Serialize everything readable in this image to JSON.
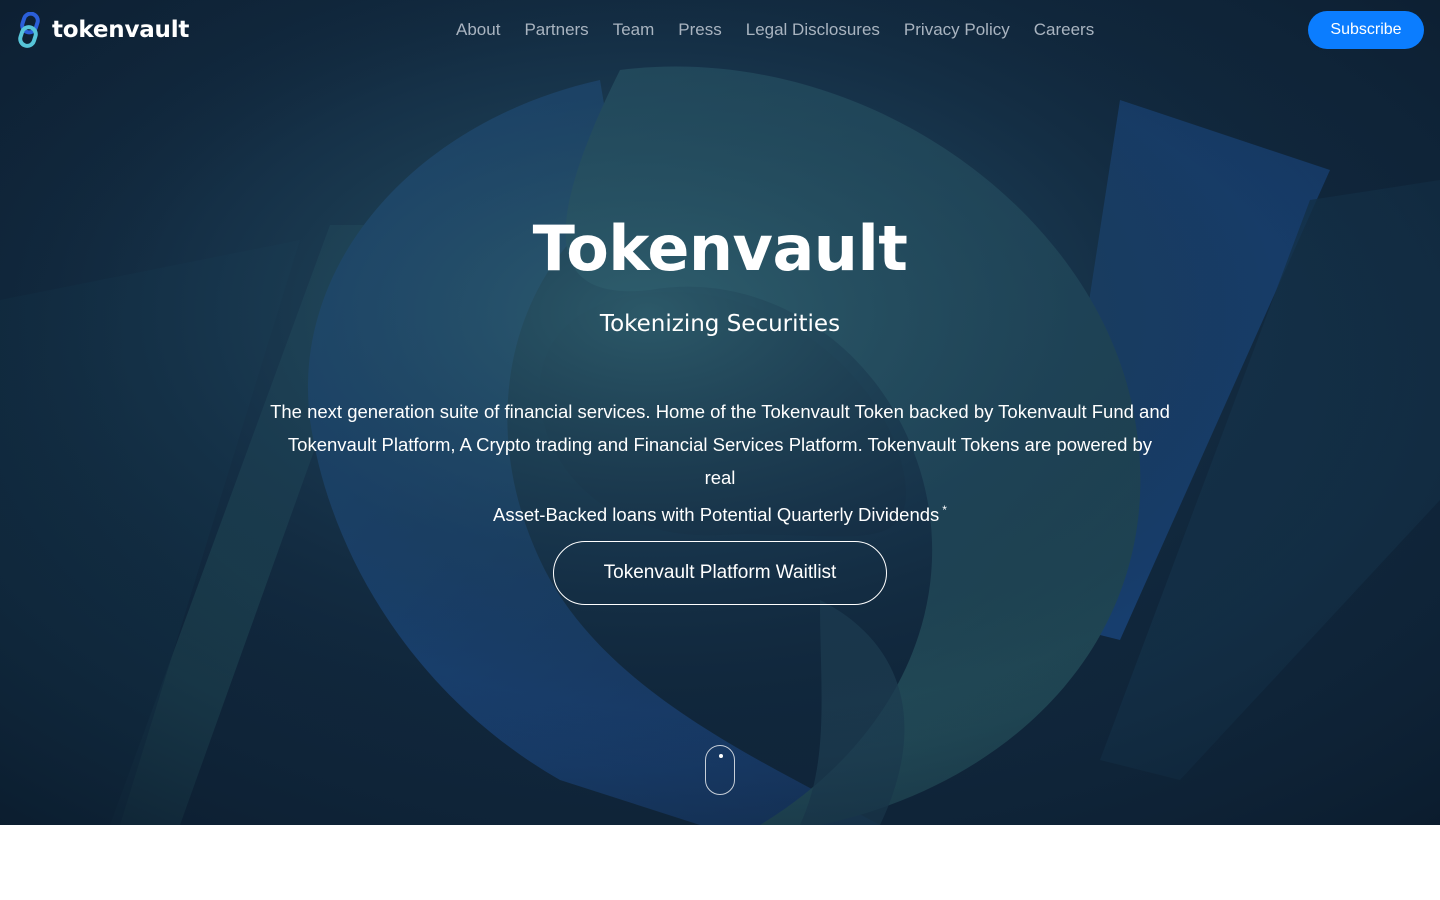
{
  "brand": {
    "name": "tokenvault",
    "logo_icon": "chain-link-icon",
    "logo_colors": [
      "#2b5fd9",
      "#57c5d8"
    ]
  },
  "nav": {
    "links": [
      "About",
      "Partners",
      "Team",
      "Press",
      "Legal Disclosures",
      "Privacy Policy",
      "Careers"
    ],
    "subscribe_label": "Subscribe"
  },
  "hero": {
    "title": "Tokenvault",
    "subtitle": "Tokenizing Securities",
    "description_line1": "The next generation suite of financial services. Home of the Tokenvault Token backed by Tokenvault Fund and",
    "description_line2": "Tokenvault Platform, A Crypto trading and Financial Services Platform. Tokenvault Tokens are powered by real",
    "description_line3": "Asset-Backed loans with Potential Quarterly Dividends",
    "footnote_mark": "*",
    "cta_label": "Tokenvault Platform Waitlist"
  },
  "colors": {
    "hero_background": "#0f2438",
    "accent": "#0b7dff",
    "nav_link": "#a9b4c0"
  }
}
